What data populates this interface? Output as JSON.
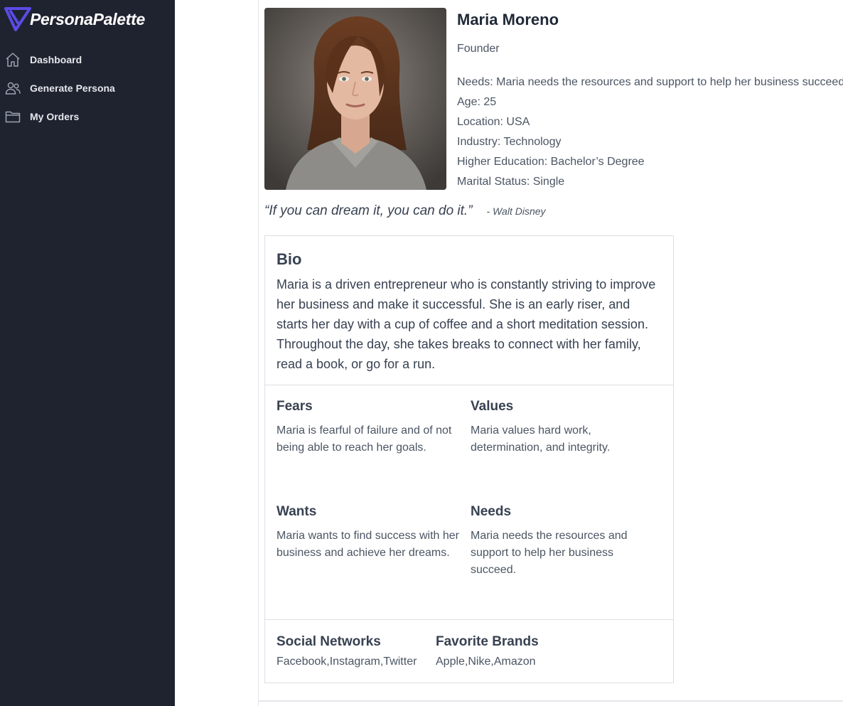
{
  "app": {
    "name": "PersonaPalette"
  },
  "sidebar": {
    "items": [
      {
        "label": "Dashboard",
        "icon": "home-icon"
      },
      {
        "label": "Generate Persona",
        "icon": "users-icon"
      },
      {
        "label": "My Orders",
        "icon": "folder-icon"
      }
    ]
  },
  "persona": {
    "name": "Maria Moreno",
    "role": "Founder",
    "needs_line": "Needs: Maria needs the resources and support to help her business succeed.",
    "age": "Age: 25",
    "location": "Location: USA",
    "industry": "Industry: Technology",
    "education": "Higher Education: Bachelor’s Degree",
    "marital": "Marital Status: Single",
    "quote": "“If you can dream it, you can do it.”",
    "quote_author": "- Walt Disney",
    "bio_title": "Bio",
    "bio": "Maria is a driven entrepreneur who is constantly striving to improve her business and make it successful. She is an early riser, and starts her day with a cup of coffee and a short meditation session. Throughout the day, she takes breaks to connect with her family, read a book, or go for a run.",
    "fears_title": "Fears",
    "fears": "Maria is fearful of failure and of not being able to reach her goals.",
    "values_title": "Values",
    "values": "Maria values hard work, determination, and integrity.",
    "wants_title": "Wants",
    "wants": "Maria wants to find success with her business and achieve her dreams.",
    "needs_title": "Needs",
    "needs": "Maria needs the resources and support to help her business succeed.",
    "social_title": "Social Networks",
    "social": "Facebook,Instagram,Twitter",
    "brands_title": "Favorite Brands",
    "brands": "Apple,Nike,Amazon"
  },
  "colors": {
    "sidebar_bg": "#1f2330",
    "brand_accent": "#5b4be6",
    "text": "#374151"
  }
}
